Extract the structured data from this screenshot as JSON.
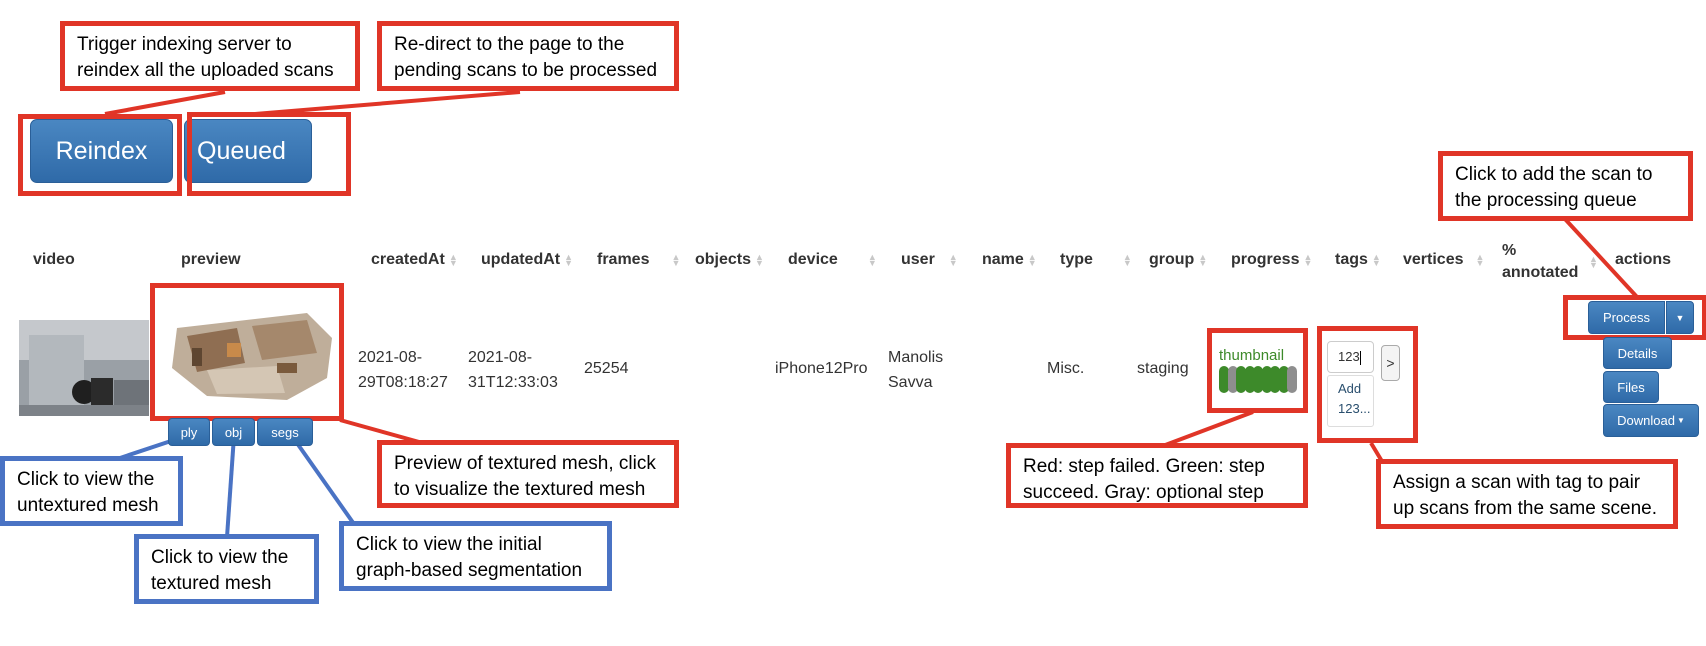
{
  "toolbar": {
    "reindex_label": "Reindex",
    "queued_label": "Queued"
  },
  "table": {
    "headers": [
      {
        "key": "video",
        "label": "video",
        "sortable": false
      },
      {
        "key": "preview",
        "label": "preview",
        "sortable": false
      },
      {
        "key": "createdAt",
        "label": "createdAt",
        "sortable": true
      },
      {
        "key": "updatedAt",
        "label": "updatedAt",
        "sortable": true
      },
      {
        "key": "frames",
        "label": "frames",
        "sortable": true
      },
      {
        "key": "objects",
        "label": "objects",
        "sortable": true
      },
      {
        "key": "device",
        "label": "device",
        "sortable": true
      },
      {
        "key": "user",
        "label": "user",
        "sortable": true
      },
      {
        "key": "name",
        "label": "name",
        "sortable": true
      },
      {
        "key": "type",
        "label": "type",
        "sortable": true
      },
      {
        "key": "group",
        "label": "group",
        "sortable": true
      },
      {
        "key": "progress",
        "label": "progress",
        "sortable": true
      },
      {
        "key": "tags",
        "label": "tags",
        "sortable": true
      },
      {
        "key": "vertices",
        "label": "vertices",
        "sortable": true
      },
      {
        "key": "annotated",
        "label": "% annotated",
        "sortable": true
      },
      {
        "key": "actions",
        "label": "actions",
        "sortable": false
      }
    ],
    "row": {
      "createdAt": "2021-08-29T08:18:27",
      "createdAt_line1": "2021-08-",
      "createdAt_line2": "29T08:18:27",
      "updatedAt_line1": "2021-08-",
      "updatedAt_line2": "31T12:33:03",
      "frames": "25254",
      "objects": "",
      "device": "iPhone12Pro",
      "user_line1": "Manolis",
      "user_line2": "Savva",
      "name": "",
      "type": "Misc.",
      "group": "staging",
      "progress_label": "thumbnail",
      "progress_steps": [
        "succeeded",
        "optional",
        "succeeded",
        "succeeded",
        "succeeded",
        "succeeded",
        "succeeded",
        "succeeded",
        "optional"
      ],
      "tag_input_value": "123",
      "tag_submit_label": ">",
      "tag_suggestion_line1": "Add",
      "tag_suggestion_line2": "123...",
      "mesh_buttons": [
        "ply",
        "obj",
        "segs"
      ],
      "actions": {
        "process_label": "Process",
        "details_label": "Details",
        "files_label": "Files",
        "download_label": "Download"
      }
    }
  },
  "callouts": {
    "reindex": [
      "Trigger indexing server to",
      "reindex all the uploaded scans"
    ],
    "queued": [
      "Re-direct to the page to the",
      "pending scans to be processed"
    ],
    "process": [
      "Click to add the scan to",
      "the processing queue"
    ],
    "preview": [
      "Preview of textured mesh, click",
      "to visualize the textured mesh"
    ],
    "progress": [
      "Red: step failed. Green: step",
      "succeed. Gray: optional step"
    ],
    "tags": [
      "Assign a scan with tag to pair",
      "up scans from the same scene."
    ],
    "ply": [
      "Click to view the",
      "untextured mesh"
    ],
    "obj": [
      "Click to view the",
      "textured mesh"
    ],
    "segs": [
      "Click to view the initial",
      "graph-based segmentation"
    ]
  },
  "colors": {
    "callout_red": "#e03527",
    "callout_blue": "#4a73c4",
    "button_blue": "#337ab7",
    "progress_success": "#3d8a2a",
    "progress_optional": "#8e8e8e"
  }
}
